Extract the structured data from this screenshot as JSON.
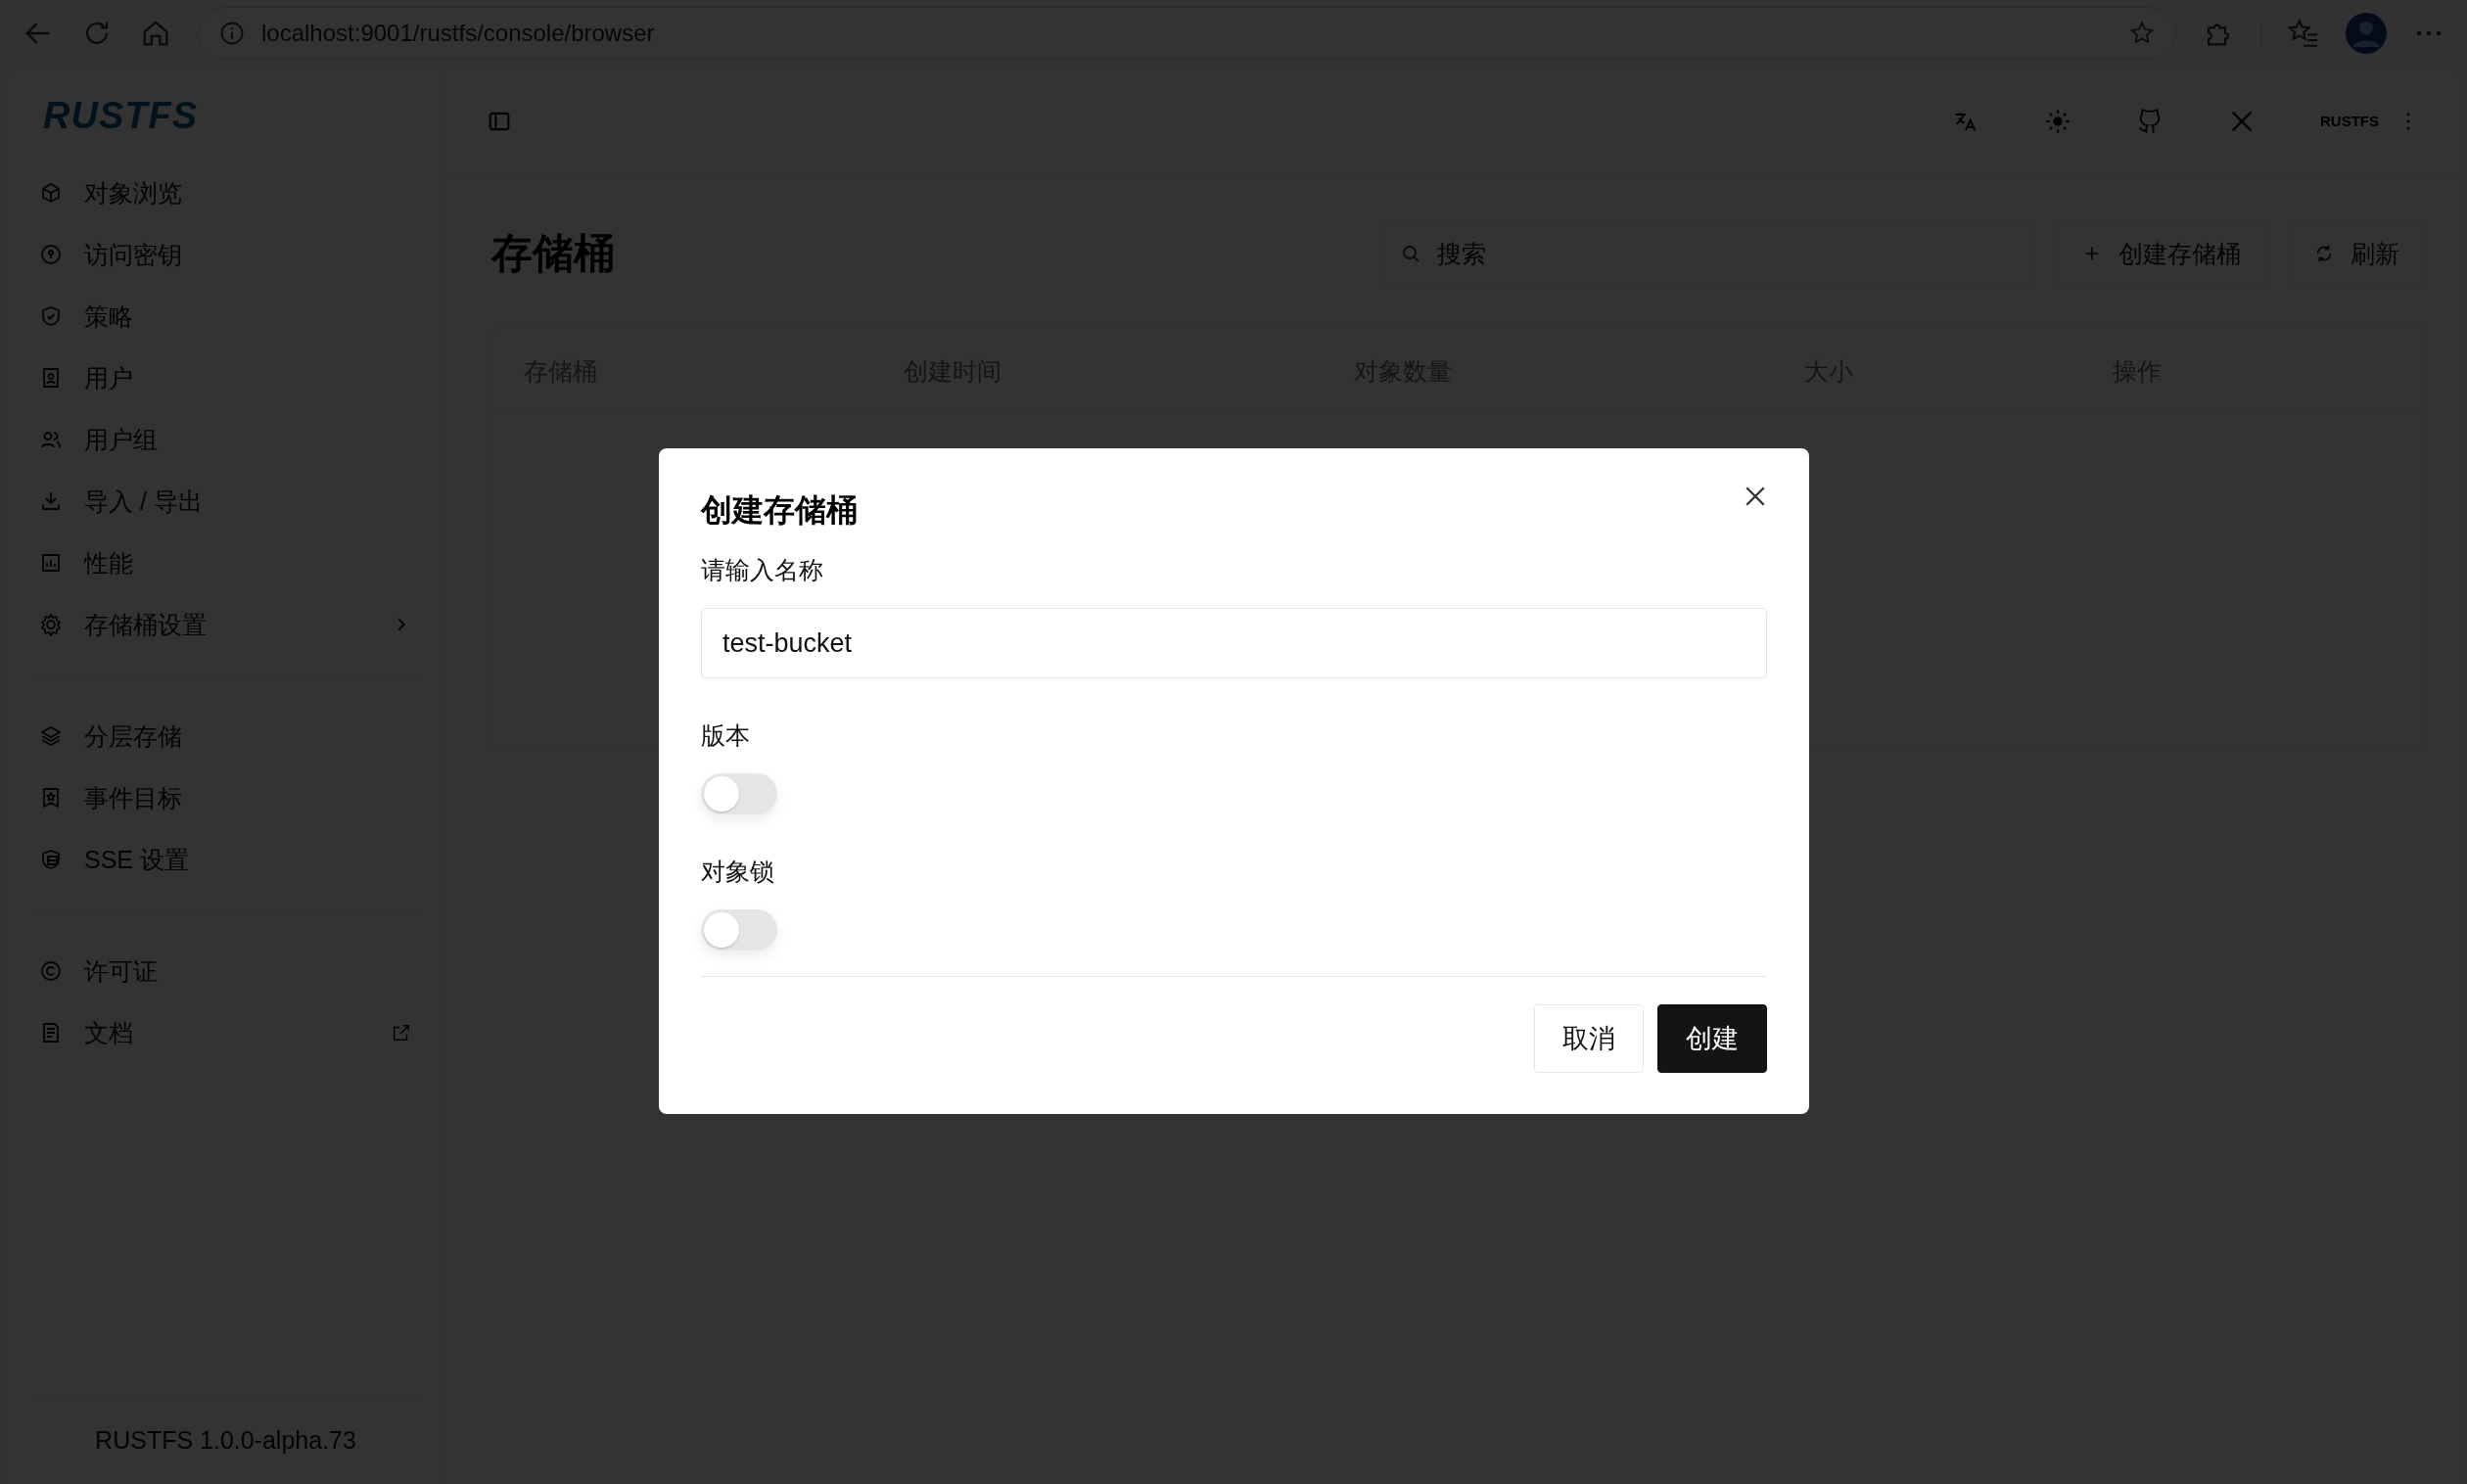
{
  "browser": {
    "url": "localhost:9001/rustfs/console/browser"
  },
  "sidebar": {
    "logo": "RUSTFS",
    "groups": [
      [
        {
          "label": "对象浏览"
        },
        {
          "label": "访问密钥"
        },
        {
          "label": "策略"
        },
        {
          "label": "用户"
        },
        {
          "label": "用户组"
        },
        {
          "label": "导入 / 导出"
        },
        {
          "label": "性能"
        },
        {
          "label": "存储桶设置",
          "kind": "submenu"
        }
      ],
      [
        {
          "label": "分层存储"
        },
        {
          "label": "事件目标"
        },
        {
          "label": "SSE 设置"
        }
      ],
      [
        {
          "label": "许可证"
        },
        {
          "label": "文档",
          "kind": "external"
        }
      ]
    ],
    "version": "RUSTFS 1.0.0-alpha.73"
  },
  "topbar": {
    "user_logo": "RUSTFS"
  },
  "page": {
    "title": "存储桶",
    "search": {
      "placeholder": "搜索"
    },
    "buttons": [
      {
        "label": "创建存储桶",
        "kind": "create"
      },
      {
        "label": "刷新",
        "kind": "refresh"
      }
    ],
    "table": {
      "columns": [
        "存储桶",
        "创建时间",
        "对象数量",
        "大小",
        "操作"
      ]
    }
  },
  "dialog": {
    "title": "创建存储桶",
    "field": {
      "label": "请输入名称",
      "value": "test-bucket"
    },
    "switches": [
      {
        "label": "版本",
        "on": false
      },
      {
        "label": "对象锁",
        "on": false
      }
    ],
    "buttons": [
      {
        "label": "取消",
        "kind": "secondary"
      },
      {
        "label": "创建",
        "kind": "primary"
      }
    ]
  }
}
